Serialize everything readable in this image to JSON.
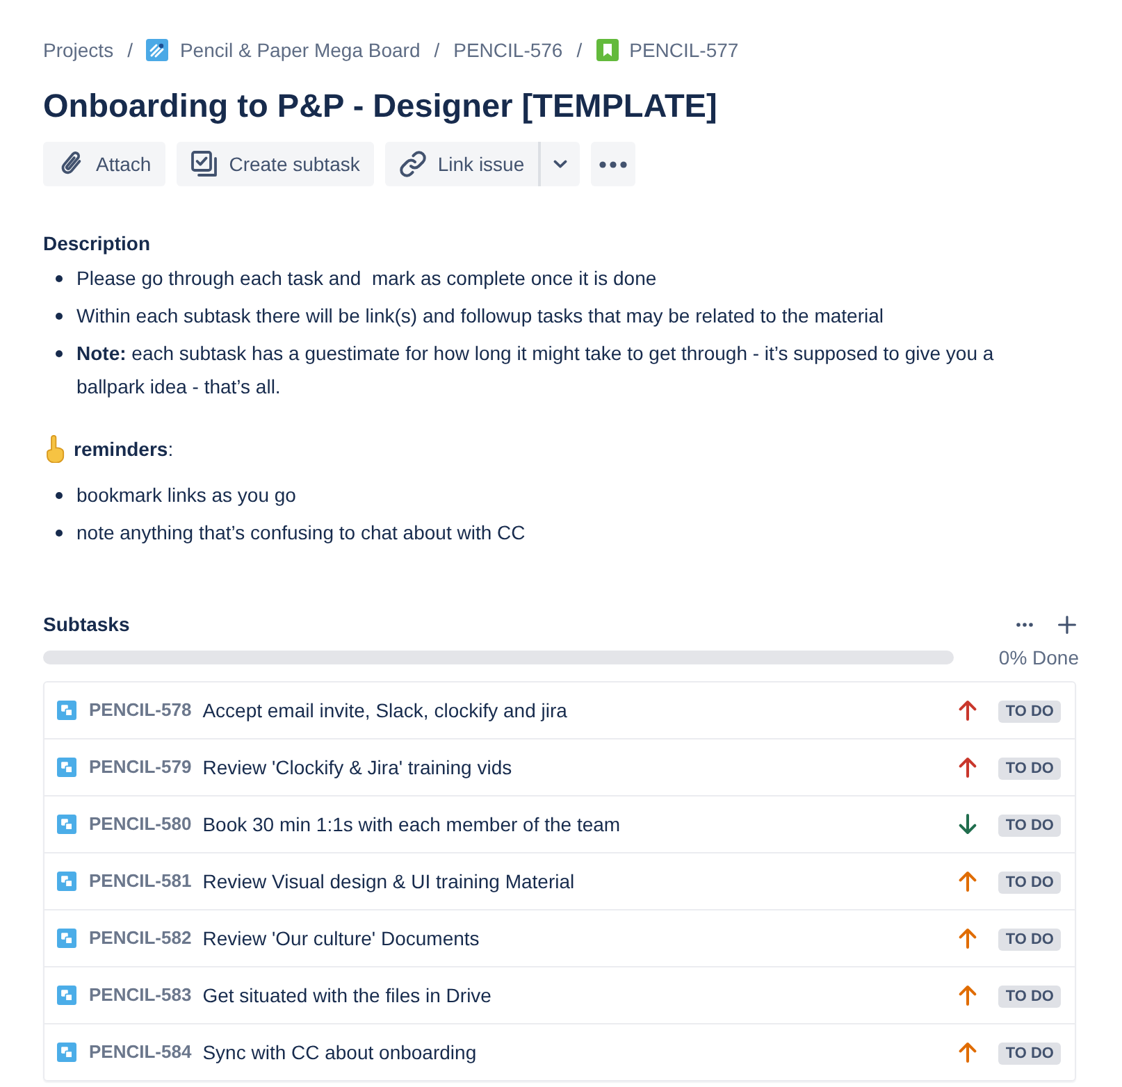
{
  "breadcrumbs": [
    {
      "kind": "plain",
      "label": "Projects"
    },
    {
      "kind": "separator",
      "label": "/"
    },
    {
      "kind": "project",
      "label": "Pencil & Paper Mega Board"
    },
    {
      "kind": "separator",
      "label": "/"
    },
    {
      "kind": "plain",
      "label": "PENCIL-576"
    },
    {
      "kind": "separator",
      "label": "/"
    },
    {
      "kind": "story",
      "label": "PENCIL-577"
    }
  ],
  "title": "Onboarding to P&P - Designer [TEMPLATE]",
  "toolbar": [
    {
      "kind": "attach",
      "label": "Attach"
    },
    {
      "kind": "subtask",
      "label": "Create subtask"
    },
    {
      "kind": "link",
      "label": "Link issue"
    },
    {
      "kind": "more"
    }
  ],
  "description": {
    "heading": "Description",
    "bullets": [
      "Please go through each task and  mark as complete once it is done",
      "Within each subtask there will be link(s) and followup tasks that may be related to the material",
      "**Note:** each subtask has a guestimate for how long it might take to get through - it’s supposed to give you a ballpark idea - that’s all."
    ]
  },
  "reminders": {
    "heading": "**reminders**:",
    "bullets": [
      "bookmark links as you go",
      "note anything that’s confusing to chat about with CC"
    ]
  },
  "subtasks": {
    "heading": "Subtasks",
    "progress": {
      "level": 0,
      "reading": "0% Done"
    },
    "rows": [
      {
        "key": "PENCIL-578",
        "summary": "Accept email invite, Slack, clockify and jira",
        "kind": "up",
        "color": "#c9372c",
        "status": "TO DO"
      },
      {
        "key": "PENCIL-579",
        "summary": "Review 'Clockify & Jira' training vids",
        "kind": "up",
        "color": "#c9372c",
        "status": "TO DO"
      },
      {
        "key": "PENCIL-580",
        "summary": "Book 30 min 1:1s with each member of the team",
        "kind": "down",
        "color": "#216e4e",
        "status": "TO DO"
      },
      {
        "key": "PENCIL-581",
        "summary": "Review Visual design & UI training Material",
        "kind": "up",
        "color": "#e06c00",
        "status": "TO DO"
      },
      {
        "key": "PENCIL-582",
        "summary": "Review 'Our culture' Documents",
        "kind": "up",
        "color": "#e06c00",
        "status": "TO DO"
      },
      {
        "key": "PENCIL-583",
        "summary": "Get situated with the files in Drive",
        "kind": "up",
        "color": "#e06c00",
        "status": "TO DO"
      },
      {
        "key": "PENCIL-584",
        "summary": "Sync with CC about onboarding",
        "kind": "up",
        "color": "#e06c00",
        "status": "TO DO"
      }
    ]
  }
}
